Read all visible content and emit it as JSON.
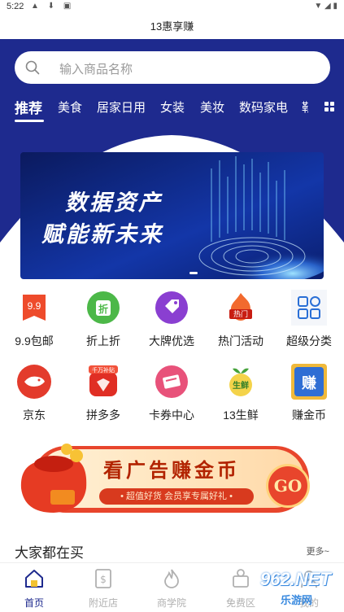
{
  "status_bar": {
    "time": "5:22"
  },
  "app": {
    "title": "13惠享赚"
  },
  "search": {
    "placeholder": "输入商品名称"
  },
  "category_tabs": [
    {
      "label": "推荐",
      "active": true
    },
    {
      "label": "美食",
      "active": false
    },
    {
      "label": "居家日用",
      "active": false
    },
    {
      "label": "女装",
      "active": false
    },
    {
      "label": "美妆",
      "active": false
    },
    {
      "label": "数码家电",
      "active": false
    },
    {
      "label": "鞋",
      "active": false
    }
  ],
  "banner": {
    "line1": "数据资产",
    "line2": "赋能新未来"
  },
  "quick_icons": [
    {
      "label": "9.9包邮",
      "icon": "nine-nine-tag-icon",
      "badge": "9.9"
    },
    {
      "label": "折上折",
      "icon": "discount-bag-icon",
      "badge": "折"
    },
    {
      "label": "大牌优选",
      "icon": "price-tag-icon"
    },
    {
      "label": "热门活动",
      "icon": "hot-event-icon",
      "badge": "热门"
    },
    {
      "label": "超级分类",
      "icon": "category-grid-icon"
    },
    {
      "label": "京东",
      "icon": "jd-dog-icon"
    },
    {
      "label": "拼多多",
      "icon": "pinduoduo-icon",
      "badge": "千万补贴"
    },
    {
      "label": "卡券中心",
      "icon": "coupon-card-icon"
    },
    {
      "label": "13生鲜",
      "icon": "fresh-produce-icon",
      "badge": "生鲜"
    },
    {
      "label": "赚金币",
      "icon": "earn-coins-icon",
      "badge": "赚"
    }
  ],
  "ad": {
    "title": "看广告赚金币",
    "subtitle": "• 超值好货 会员享专属好礼 •",
    "button": "GO"
  },
  "section": {
    "title": "大家都在买",
    "more": "更多~"
  },
  "bottom_nav": [
    {
      "label": "首页",
      "icon": "home-icon",
      "active": true
    },
    {
      "label": "附近店",
      "icon": "nearby-store-icon",
      "active": false
    },
    {
      "label": "商学院",
      "icon": "flame-icon",
      "active": false
    },
    {
      "label": "免费区",
      "icon": "gift-icon",
      "active": false
    },
    {
      "label": "我的",
      "icon": "profile-icon",
      "active": false
    }
  ],
  "watermark": {
    "text": "962.NET",
    "sub": "乐游网"
  },
  "colors": {
    "primary": "#1e2a8e",
    "accent": "#e8452c"
  }
}
